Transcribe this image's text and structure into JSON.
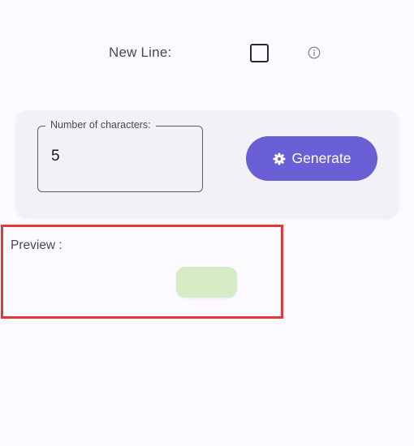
{
  "options": {
    "new_line_label": "New Line:",
    "new_line_checked": false
  },
  "generator": {
    "field_label": "Number of characters:",
    "field_value": "5",
    "generate_label": "Generate"
  },
  "preview": {
    "label": "Preview :",
    "value": ""
  },
  "colors": {
    "accent": "#6a5fd4",
    "preview_chip": "#d5ecc6",
    "highlight_border": "#e53935",
    "card_background": "#f3f1f6"
  },
  "icons": {
    "info": "info-icon",
    "generate": "gear-icon"
  }
}
